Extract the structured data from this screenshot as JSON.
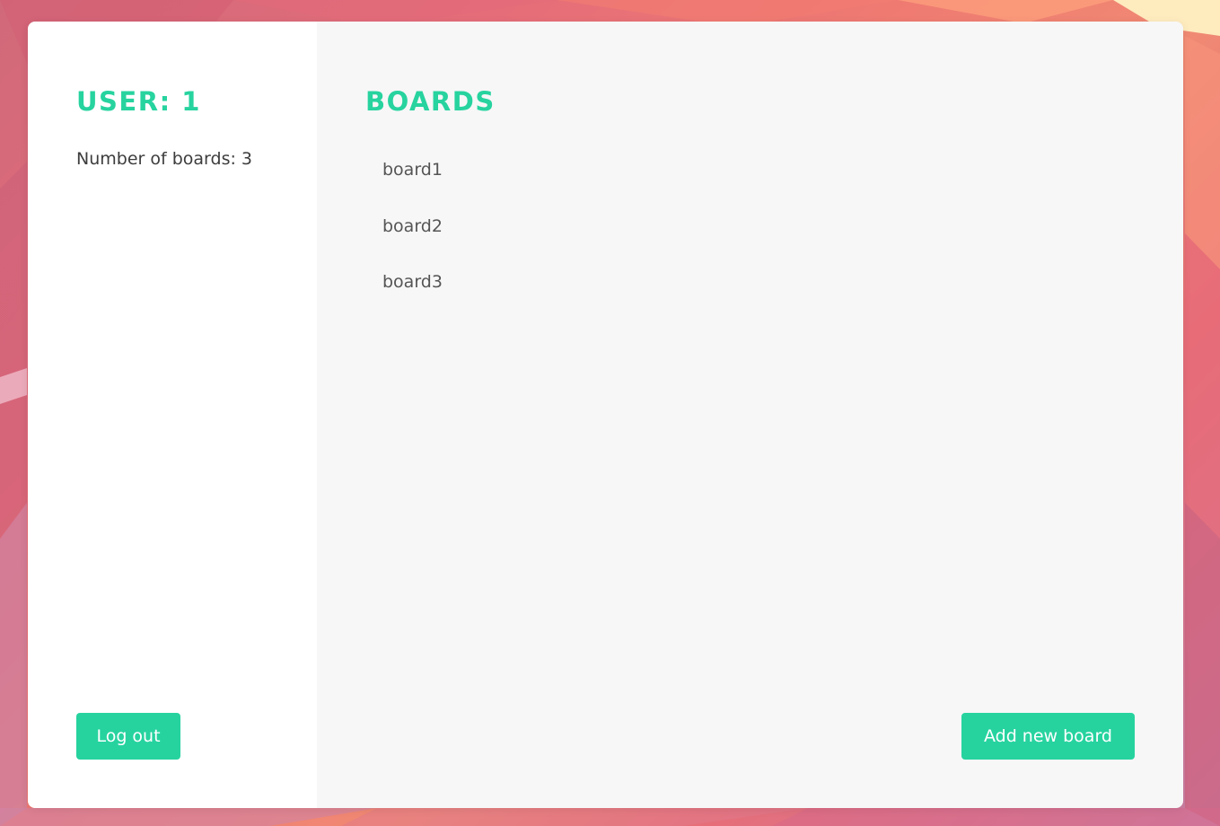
{
  "sidebar": {
    "heading": "USER: 1",
    "count_text": "Number of boards: 3",
    "logout_label": "Log out"
  },
  "main": {
    "heading": "BOARDS",
    "boards": [
      "board1",
      "board2",
      "board3"
    ],
    "add_label": "Add new board"
  },
  "colors": {
    "accent": "#26d39f",
    "sidebar_bg": "#ffffff",
    "main_bg": "#f7f7f7",
    "text": "#3d3d3d"
  }
}
